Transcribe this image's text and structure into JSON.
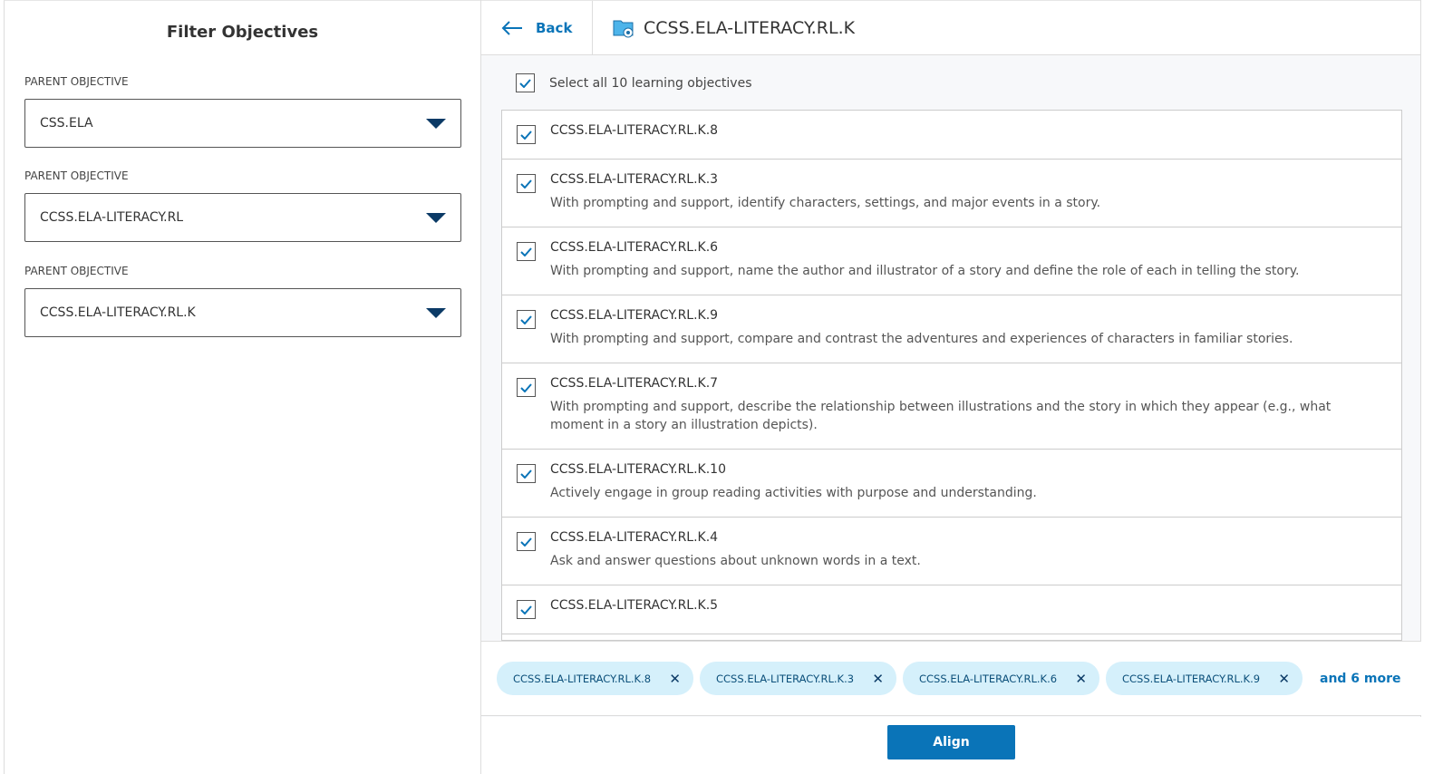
{
  "filter": {
    "title": "Filter Objectives",
    "fields": [
      {
        "label": "PARENT OBJECTIVE",
        "value": "CSS.ELA"
      },
      {
        "label": "PARENT OBJECTIVE",
        "value": "CCSS.ELA-LITERACY.RL"
      },
      {
        "label": "PARENT OBJECTIVE",
        "value": "CCSS.ELA-LITERACY.RL.K"
      }
    ]
  },
  "header": {
    "back_label": "Back",
    "title": "CCSS.ELA-LITERACY.RL.K",
    "icon": "folder-gear-icon"
  },
  "select_all": {
    "label": "Select all 10 learning objectives",
    "checked": true
  },
  "objectives": [
    {
      "code": "CCSS.ELA-LITERACY.RL.K.8",
      "desc": "",
      "checked": true
    },
    {
      "code": "CCSS.ELA-LITERACY.RL.K.3",
      "desc": "With prompting and support, identify characters, settings, and major events in a story.",
      "checked": true
    },
    {
      "code": "CCSS.ELA-LITERACY.RL.K.6",
      "desc": "With prompting and support, name the author and illustrator of a story and define the role of each in telling the story.",
      "checked": true
    },
    {
      "code": "CCSS.ELA-LITERACY.RL.K.9",
      "desc": "With prompting and support, compare and contrast the adventures and experiences of characters in familiar stories.",
      "checked": true
    },
    {
      "code": "CCSS.ELA-LITERACY.RL.K.7",
      "desc": "With prompting and support, describe the relationship between illustrations and the story in which they appear (e.g., what moment in a story an illustration depicts).",
      "checked": true
    },
    {
      "code": "CCSS.ELA-LITERACY.RL.K.10",
      "desc": "Actively engage in group reading activities with purpose and understanding.",
      "checked": true
    },
    {
      "code": "CCSS.ELA-LITERACY.RL.K.4",
      "desc": "Ask and answer questions about unknown words in a text.",
      "checked": true
    },
    {
      "code": "CCSS.ELA-LITERACY.RL.K.5",
      "desc": "",
      "checked": true
    }
  ],
  "chips": [
    "CCSS.ELA-LITERACY.RL.K.8",
    "CCSS.ELA-LITERACY.RL.K.3",
    "CCSS.ELA-LITERACY.RL.K.6",
    "CCSS.ELA-LITERACY.RL.K.9"
  ],
  "chip_remove": "✕",
  "more_label": "and 6 more",
  "align_label": "Align",
  "colors": {
    "accent": "#0a74b8",
    "chip_bg": "#d5f0fb"
  }
}
